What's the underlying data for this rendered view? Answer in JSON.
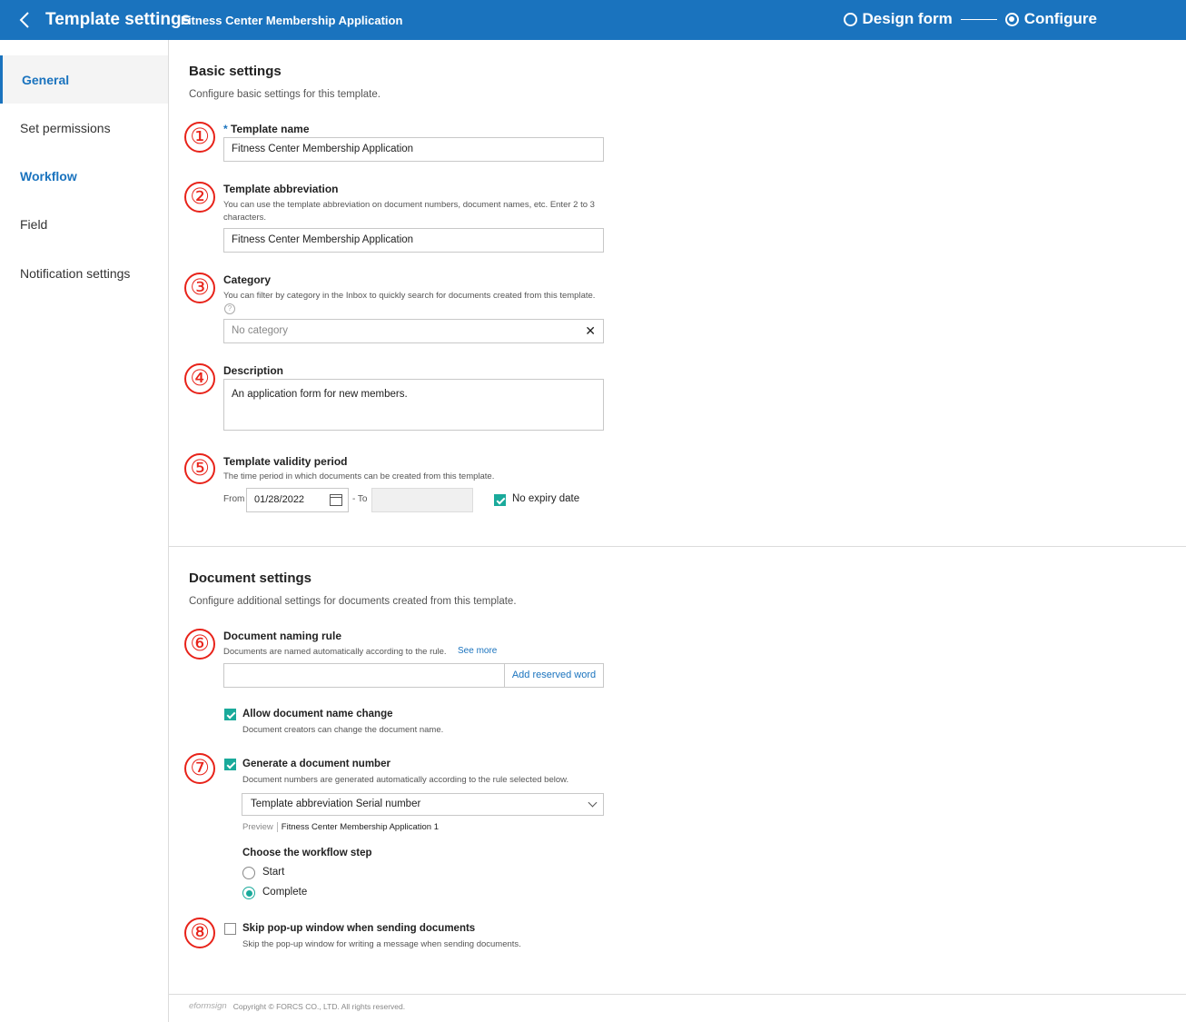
{
  "header": {
    "title": "Template settings",
    "subtitle": "Fitness Center Membership Application",
    "steps": [
      "Design form",
      "Configure"
    ]
  },
  "sidebar": {
    "items": [
      "General",
      "Set permissions",
      "Workflow",
      "Field",
      "Notification settings"
    ]
  },
  "basic": {
    "title": "Basic settings",
    "desc": "Configure basic settings for this template.",
    "template_name_label": "Template name",
    "required_mark": "*",
    "template_name_value": "Fitness Center Membership Application",
    "abbr_label": "Template abbreviation",
    "abbr_help": "You can use the template abbreviation on document numbers, document names, etc. Enter 2 to 3 characters.",
    "abbr_value": "Fitness Center Membership Application",
    "category_label": "Category",
    "category_help": "You can filter by category in the Inbox to quickly search for documents created from this template.",
    "category_value": "No category",
    "clear_glyph": "✕",
    "help_glyph": "?",
    "desc_label": "Description",
    "desc_value": "An application form for new members.",
    "validity_label": "Template validity period",
    "validity_help": "The time period in which documents can be created from this template.",
    "from_label": "From",
    "from_value": "01/28/2022",
    "to_label": "- To",
    "no_expiry_label": "No expiry date",
    "no_expiry_checked": true
  },
  "document": {
    "title": "Document settings",
    "desc": "Configure additional settings for documents created from this template.",
    "naming_label": "Document naming rule",
    "naming_help": "Documents are named automatically according to the rule.",
    "see_more": "See more",
    "add_reserved": "Add reserved word",
    "allow_change_label": "Allow document name change",
    "allow_change_help": "Document creators can change the document name.",
    "allow_change_checked": true,
    "gen_number_label": "Generate a document number",
    "gen_number_help": "Document numbers are generated automatically according to the rule selected below.",
    "gen_number_checked": true,
    "number_rule_value": "Template abbreviation Serial number",
    "preview_label": "Preview",
    "preview_value": "Fitness Center Membership Application 1",
    "workflow_step_label": "Choose the workflow step",
    "workflow_options": [
      "Start",
      "Complete"
    ],
    "workflow_selected": "Complete",
    "skip_popup_label": "Skip pop-up window when sending documents",
    "skip_popup_help": "Skip the pop-up window for writing a message when sending documents.",
    "skip_popup_checked": false
  },
  "annotations": [
    "①",
    "②",
    "③",
    "④",
    "⑤",
    "⑥",
    "⑦",
    "⑧"
  ],
  "footer": {
    "logo": "eformsign",
    "copyright": "Copyright © FORCS CO., LTD. All rights reserved."
  },
  "colors": {
    "header_bg": "#1a73be",
    "accent": "#1a73be",
    "check": "#1aaa9b",
    "annotation": "#e8231a"
  }
}
